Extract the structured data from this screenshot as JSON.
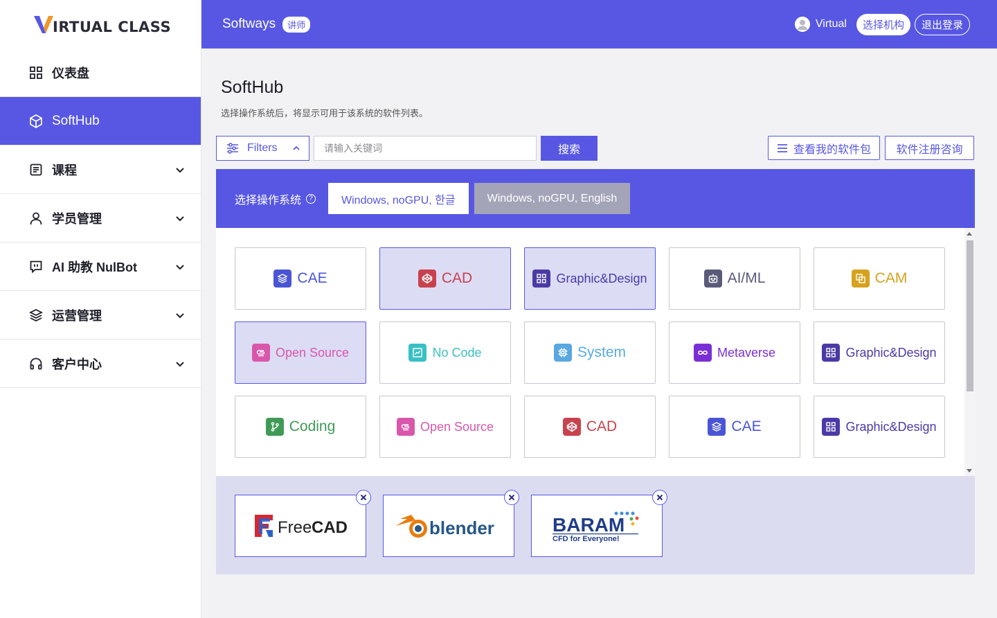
{
  "brand_logo": {
    "text": "IRTUAL CLASS"
  },
  "sidebar": {
    "items": [
      {
        "label": "仪表盘",
        "icon": "dashboard-grid-icon"
      },
      {
        "label": "SoftHub",
        "icon": "cube-icon",
        "active": true
      },
      {
        "label": "课程",
        "icon": "book-icon"
      },
      {
        "label": "学员管理",
        "icon": "user-icon"
      },
      {
        "label": "AI 助教 NulBot",
        "icon": "chat-bot-icon"
      },
      {
        "label": "运营管理",
        "icon": "layers-icon"
      },
      {
        "label": "客户中心",
        "icon": "headphones-icon"
      }
    ]
  },
  "header": {
    "brand": "Softways",
    "role_badge": "讲师",
    "user_name": "Virtual",
    "select_org": "选择机构",
    "logout": "退出登录"
  },
  "page": {
    "title": "SoftHub",
    "subtitle": "选择操作系统后，将显示可用于该系统的软件列表。"
  },
  "toolbar": {
    "filters_label": "Filters",
    "search_placeholder": "请输入关键词",
    "search_button": "搜索",
    "my_packages": "查看我的软件包",
    "registration": "软件注册咨询"
  },
  "os_selector": {
    "label": "选择操作系统",
    "options": [
      {
        "label": "Windows, noGPU, 한글",
        "selected": true
      },
      {
        "label": "Windows, noGPU, English",
        "selected": false
      }
    ]
  },
  "categories": [
    {
      "label": "CAE",
      "color": "#4a55d6",
      "icon": "layers-icon",
      "selected": false
    },
    {
      "label": "CAD",
      "color": "#c8424e",
      "icon": "codepen-icon",
      "selected": true
    },
    {
      "label": "Graphic&Design",
      "color": "#4b3aa6",
      "icon": "grid-icon",
      "selected": true
    },
    {
      "label": "AI/ML",
      "color": "#5a5a7a",
      "icon": "robot-icon",
      "selected": false
    },
    {
      "label": "CAM",
      "color": "#d6a21e",
      "icon": "copy-icon",
      "selected": false
    },
    {
      "label": "Open Source",
      "color": "#d957ab",
      "icon": "paperclip-icon",
      "selected": true
    },
    {
      "label": "No Code",
      "color": "#39c0c4",
      "icon": "chart-icon",
      "selected": false
    },
    {
      "label": "System",
      "color": "#5aa8e0",
      "icon": "cpu-icon",
      "selected": false
    },
    {
      "label": "Metaverse",
      "color": "#7a2fd6",
      "icon": "infinity-icon",
      "selected": false
    },
    {
      "label": "Graphic&Design",
      "color": "#4b3aa6",
      "icon": "grid-icon",
      "selected": false
    },
    {
      "label": "Coding",
      "color": "#3f9a55",
      "icon": "git-branch-icon",
      "selected": false
    },
    {
      "label": "Open Source",
      "color": "#d957ab",
      "icon": "paperclip-icon",
      "selected": false
    },
    {
      "label": "CAD",
      "color": "#c8424e",
      "icon": "codepen-icon",
      "selected": false
    },
    {
      "label": "CAE",
      "color": "#4a55d6",
      "icon": "layers-icon",
      "selected": false
    },
    {
      "label": "Graphic&Design",
      "color": "#4b3aa6",
      "icon": "grid-icon",
      "selected": false
    }
  ],
  "selected_packages": [
    {
      "name": "FreeCAD",
      "logo_text_a": "Free",
      "logo_text_b": "CAD"
    },
    {
      "name": "blender",
      "logo_text": "blender"
    },
    {
      "name": "BARAM",
      "logo_text": "BARAM",
      "tagline": "CFD for Everyone!"
    }
  ],
  "colors": {
    "accent": "#5757e4",
    "unselected_tab": "#a4a4b9",
    "tray": "#dcdcf1"
  }
}
